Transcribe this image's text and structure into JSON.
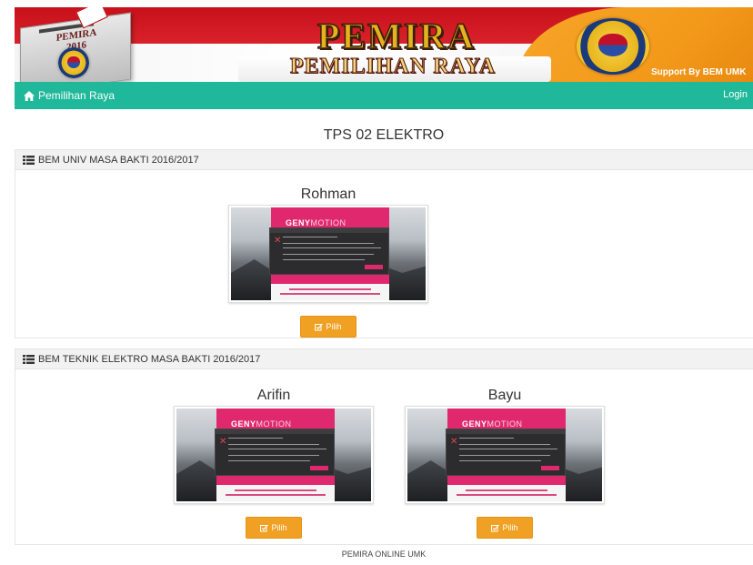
{
  "banner": {
    "box_text_line1": "PEMIRA",
    "box_text_line2": "2016",
    "title": "PEMIRA",
    "subtitle": "PEMILIHAN RAYA",
    "support_text": "Support By BEM UMK"
  },
  "navbar": {
    "brand": "Pemilihan Raya",
    "login": "Login"
  },
  "page": {
    "title": "TPS 02 ELEKTRO"
  },
  "sections": [
    {
      "header": "BEM UNIV MASA BAKTI 2016/2017",
      "candidates": [
        {
          "name": "Rohman",
          "button": "Pilih"
        }
      ]
    },
    {
      "header": "BEM TEKNIK ELEKTRO MASA BAKTI 2016/2017",
      "candidates": [
        {
          "name": "Arifin",
          "button": "Pilih"
        },
        {
          "name": "Bayu",
          "button": "Pilih"
        }
      ]
    }
  ],
  "thumbnail": {
    "logo_bold": "GENY",
    "logo_light": "MOTION"
  },
  "footer": {
    "text": "PEMIRA ONLINE UMK"
  },
  "colors": {
    "navbar": "#1fb89a",
    "button": "#f0a023",
    "banner_red": "#c8101a",
    "banner_orange": "#f39a1b"
  }
}
